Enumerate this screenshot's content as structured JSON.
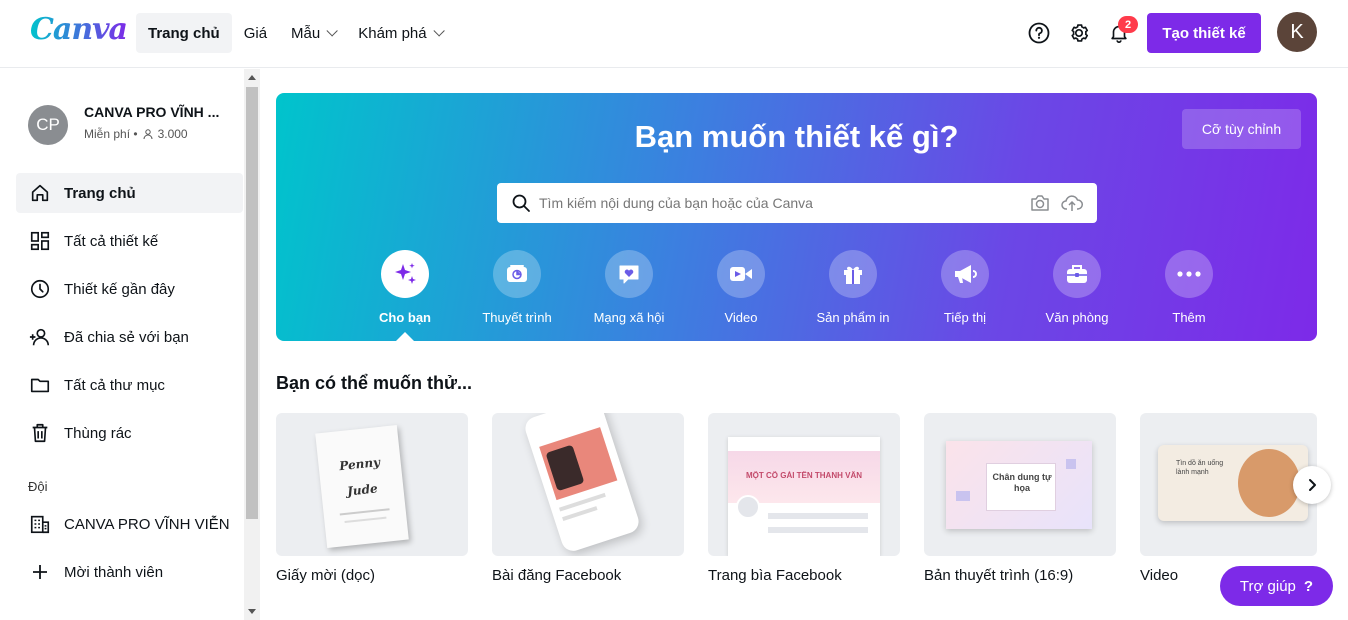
{
  "app": {
    "logo": "Canva"
  },
  "nav": {
    "items": [
      {
        "label": "Trang chủ",
        "active": true,
        "dropdown": false
      },
      {
        "label": "Giá",
        "active": false,
        "dropdown": false
      },
      {
        "label": "Mẫu",
        "active": false,
        "dropdown": true
      },
      {
        "label": "Khám phá",
        "active": false,
        "dropdown": true
      }
    ]
  },
  "topbar": {
    "notification_count": "2",
    "create_label": "Tạo thiết kế",
    "avatar_initial": "K",
    "icons": [
      "help-icon",
      "gear-icon",
      "bell-icon"
    ]
  },
  "account": {
    "initials": "CP",
    "name": "CANVA PRO VĨNH ...",
    "plan": "Miễn phí •",
    "members": "3.000"
  },
  "sidebar": {
    "items": [
      {
        "label": "Trang chủ",
        "icon": "home-icon",
        "active": true
      },
      {
        "label": "Tất cả thiết kế",
        "icon": "grid-icon",
        "active": false
      },
      {
        "label": "Thiết kế gần đây",
        "icon": "clock-icon",
        "active": false
      },
      {
        "label": "Đã chia sẻ với bạn",
        "icon": "people-icon",
        "active": false
      },
      {
        "label": "Tất cả thư mục",
        "icon": "folder-icon",
        "active": false
      },
      {
        "label": "Thùng rác",
        "icon": "trash-icon",
        "active": false
      }
    ],
    "team_heading": "Đội",
    "team_items": [
      {
        "label": "CANVA PRO VĨNH VIỄN",
        "icon": "building-icon"
      },
      {
        "label": "Mời thành viên",
        "icon": "plus-icon"
      }
    ]
  },
  "hero": {
    "title": "Bạn muốn thiết kế gì?",
    "custom_size_label": "Cỡ tùy chỉnh",
    "search_placeholder": "Tìm kiếm nội dung của bạn hoặc của Canva",
    "categories": [
      {
        "label": "Cho bạn",
        "icon": "sparkle-icon",
        "active": true
      },
      {
        "label": "Thuyết trình",
        "icon": "presentation-icon",
        "active": false
      },
      {
        "label": "Mạng xã hội",
        "icon": "heart-icon",
        "active": false
      },
      {
        "label": "Video",
        "icon": "video-icon",
        "active": false
      },
      {
        "label": "Sản phẩm in",
        "icon": "gift-icon",
        "active": false
      },
      {
        "label": "Tiếp thị",
        "icon": "megaphone-icon",
        "active": false
      },
      {
        "label": "Văn phòng",
        "icon": "briefcase-icon",
        "active": false
      },
      {
        "label": "Thêm",
        "icon": "more-icon",
        "active": false
      }
    ]
  },
  "suggestions": {
    "title": "Bạn có thể muốn thử...",
    "cards": [
      {
        "label": "Giấy mời (dọc)",
        "thumb_text_1": "Penny",
        "thumb_text_2": "Jude"
      },
      {
        "label": "Bài đăng Facebook"
      },
      {
        "label": "Trang bìa Facebook",
        "thumb_text_1": "MỘT CÕ GÁI TÊN THANH VÂN"
      },
      {
        "label": "Bản thuyết trình (16:9)",
        "thumb_text_1": "Chân dung tự họa"
      },
      {
        "label": "Video",
        "thumb_text_1": "Tìn dồ ăn uống lành mạnh"
      }
    ]
  },
  "help": {
    "label": "Trợ giúp",
    "icon_text": "?"
  },
  "colors": {
    "accent": "#7d2ae8",
    "teal": "#00c4cc",
    "badge": "#ff3b4b"
  }
}
